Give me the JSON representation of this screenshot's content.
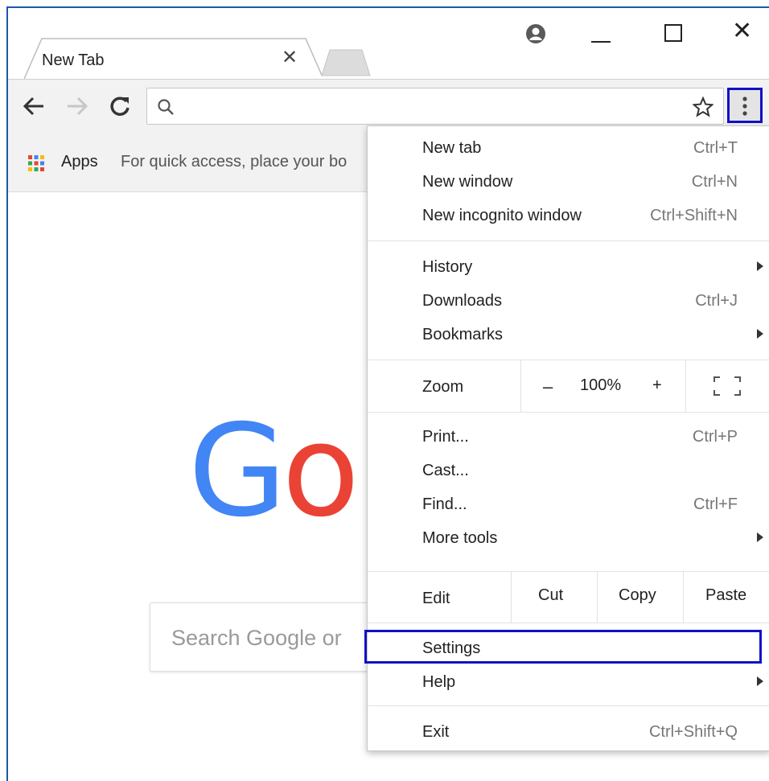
{
  "tab": {
    "title": "New Tab",
    "close_glyph": "✕"
  },
  "window_controls": {
    "close_glyph": "✕"
  },
  "bookmarks": {
    "apps_label": "Apps",
    "hint": "For quick access, place your bo"
  },
  "search": {
    "placeholder": "Search Google or"
  },
  "logo": {
    "g": "G",
    "o": "o"
  },
  "menu": {
    "group1": [
      {
        "label": "New tab",
        "shortcut": "Ctrl+T"
      },
      {
        "label": "New window",
        "shortcut": "Ctrl+N"
      },
      {
        "label": "New incognito window",
        "shortcut": "Ctrl+Shift+N"
      }
    ],
    "group2": [
      {
        "label": "History",
        "has_submenu": true
      },
      {
        "label": "Downloads",
        "shortcut": "Ctrl+J"
      },
      {
        "label": "Bookmarks",
        "has_submenu": true
      }
    ],
    "zoom": {
      "label": "Zoom",
      "minus": "–",
      "value": "100%",
      "plus": "+"
    },
    "group3": [
      {
        "label": "Print...",
        "shortcut": "Ctrl+P"
      },
      {
        "label": "Cast..."
      },
      {
        "label": "Find...",
        "shortcut": "Ctrl+F"
      },
      {
        "label": "More tools",
        "has_submenu": true
      }
    ],
    "edit": {
      "label": "Edit",
      "cut": "Cut",
      "copy": "Copy",
      "paste": "Paste"
    },
    "settings": {
      "label": "Settings"
    },
    "help": {
      "label": "Help",
      "has_submenu": true
    },
    "exit": {
      "label": "Exit",
      "shortcut": "Ctrl+Shift+Q"
    }
  },
  "colors": {
    "highlight": "#1010c8",
    "google_blue": "#4285f4",
    "google_red": "#ea4335"
  },
  "icons": [
    "profile-icon",
    "minimize-icon",
    "maximize-icon",
    "close-icon",
    "back-arrow-icon",
    "forward-arrow-icon",
    "reload-icon",
    "search-icon",
    "star-icon",
    "kebab-menu-icon",
    "apps-grid-icon",
    "submenu-arrow-icon",
    "fullscreen-icon"
  ]
}
